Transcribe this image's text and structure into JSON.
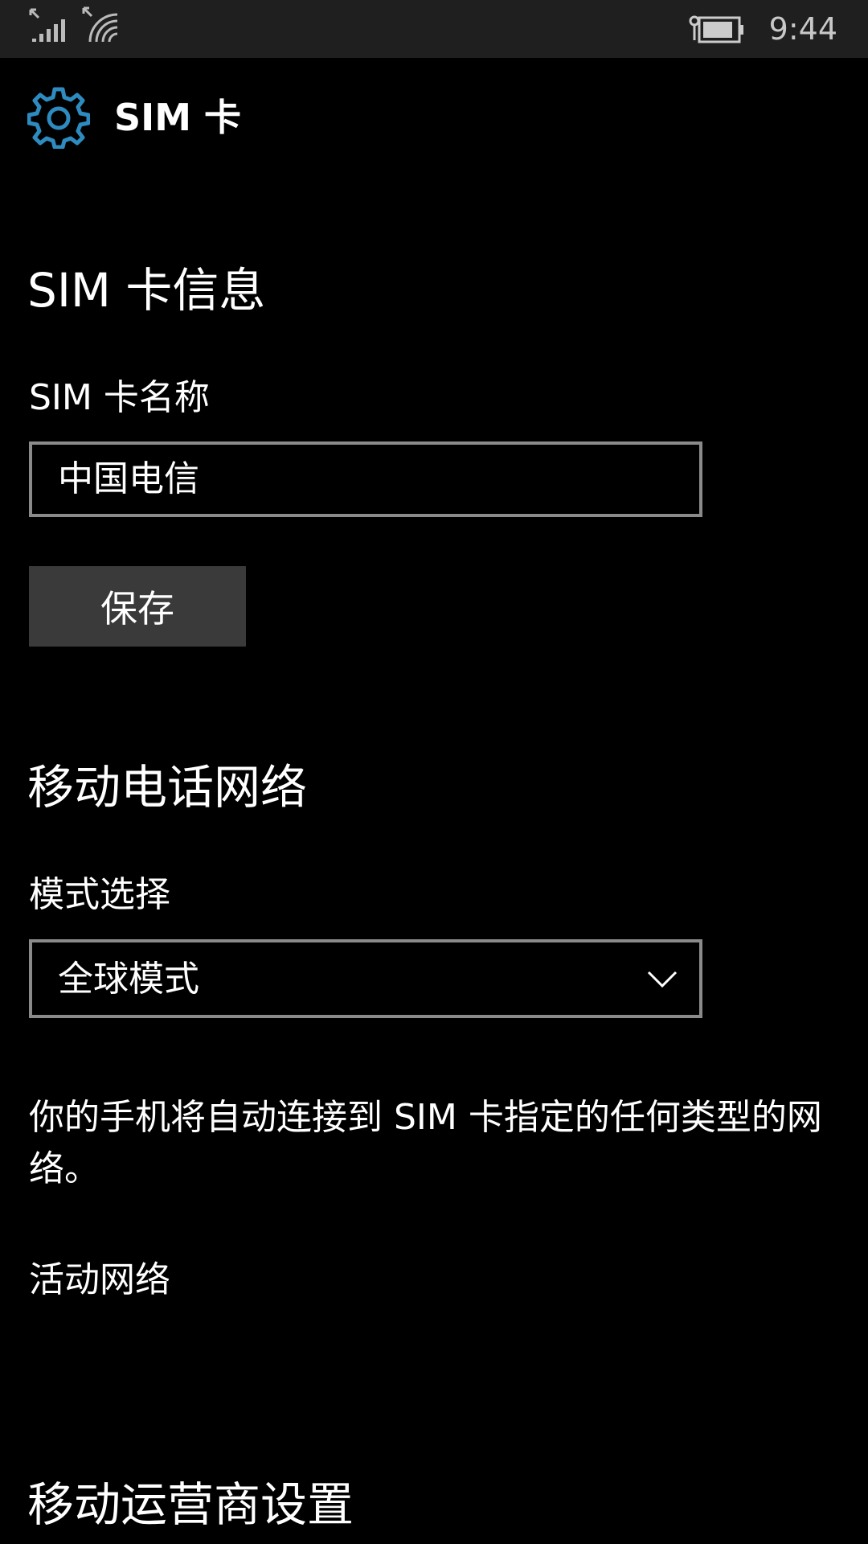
{
  "status_bar": {
    "time": "9:44",
    "icons": [
      "signal-strength-icon",
      "wifi-icon",
      "battery-icon"
    ]
  },
  "header": {
    "icon": "gear-icon",
    "title": "SIM 卡"
  },
  "sim_info": {
    "heading": "SIM 卡信息",
    "name_label": "SIM 卡名称",
    "name_value": "中国电信",
    "save_label": "保存"
  },
  "cellular": {
    "heading": "移动电话网络",
    "mode_label": "模式选择",
    "mode_value": "全球模式",
    "description": "你的手机将自动连接到 SIM 卡指定的任何类型的网络。",
    "active_network_label": "活动网络"
  },
  "carrier": {
    "heading": "移动运营商设置"
  },
  "colors": {
    "background": "#000000",
    "status_bar": "#1f1f1f",
    "accent": "#2e8bc0",
    "field_border": "#8a8a8a",
    "button": "#3a3a3a"
  }
}
